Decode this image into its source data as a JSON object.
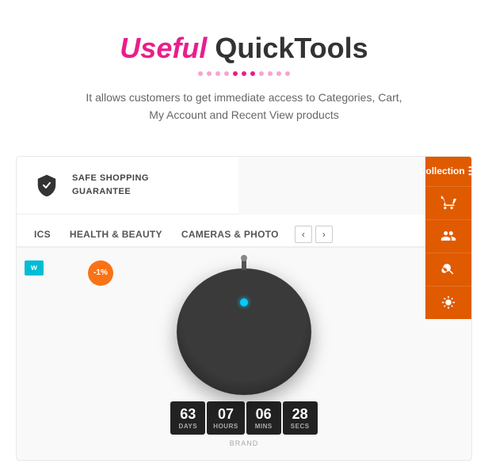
{
  "header": {
    "title_useful": "Useful",
    "title_quicktools": " QuickTools",
    "subtitle": "It allows customers to get immediate access to Categories, Cart,\nMy Account and Recent View products"
  },
  "dots": [
    1,
    2,
    3,
    4,
    5,
    6,
    7,
    8,
    9,
    10,
    11
  ],
  "active_dot": 5,
  "guarantee": {
    "line1": "SAFE SHOPPING",
    "line2": "GUARANTEE"
  },
  "sidebar": {
    "collection_label": "Collection",
    "icons": [
      "filter",
      "cart",
      "users",
      "search",
      "sun"
    ]
  },
  "nav_tabs": [
    {
      "label": "ICS",
      "active": false
    },
    {
      "label": "HEALTH & BEAUTY",
      "active": false
    },
    {
      "label": "CAMERAS & PHOTO",
      "active": false
    }
  ],
  "badges": {
    "new": "w",
    "discount": "-1%"
  },
  "countdown": [
    {
      "number": "63",
      "label": "DAYS"
    },
    {
      "number": "07",
      "label": "HOURS"
    },
    {
      "number": "06",
      "label": "MINS"
    },
    {
      "number": "28",
      "label": "SECS"
    }
  ],
  "brand": "BRAND"
}
